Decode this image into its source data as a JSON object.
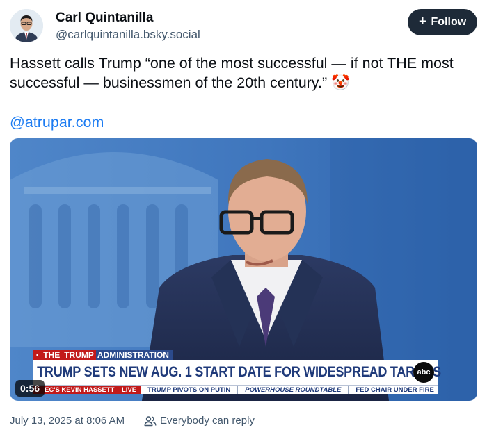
{
  "author": {
    "name": "Carl Quintanilla",
    "handle": "@carlquintanilla.bsky.social"
  },
  "follow_button": {
    "label": "Follow",
    "icon": "plus-icon"
  },
  "post": {
    "text": "Hassett calls Trump “one of the most successful — if not THE most successful — businessmen of the 20th century.” 🤡",
    "link": "@atrupar.com"
  },
  "video": {
    "duration": "0:56",
    "lower_third": {
      "tag_the": "THE",
      "tag_trump": "TRUMP",
      "tag_admin": "ADMINISTRATION",
      "headline": "TRUMP SETS NEW AUG. 1 START DATE FOR WIDESPREAD TARIFFS",
      "network_logo": "abc",
      "ticker": [
        "EC'S KEVIN HASSETT – LIVE",
        "TRUMP PIVOTS ON PUTIN",
        "POWERHOUSE ROUNDTABLE",
        "FED CHAIR UNDER FIRE"
      ]
    }
  },
  "meta": {
    "timestamp": "July 13, 2025 at 8:06 AM",
    "reply_setting": "Everybody can reply",
    "reply_icon": "people-icon"
  },
  "colors": {
    "link": "#1d7cf2",
    "follow_bg": "#1e2a38",
    "secondary_text": "#42576c"
  }
}
